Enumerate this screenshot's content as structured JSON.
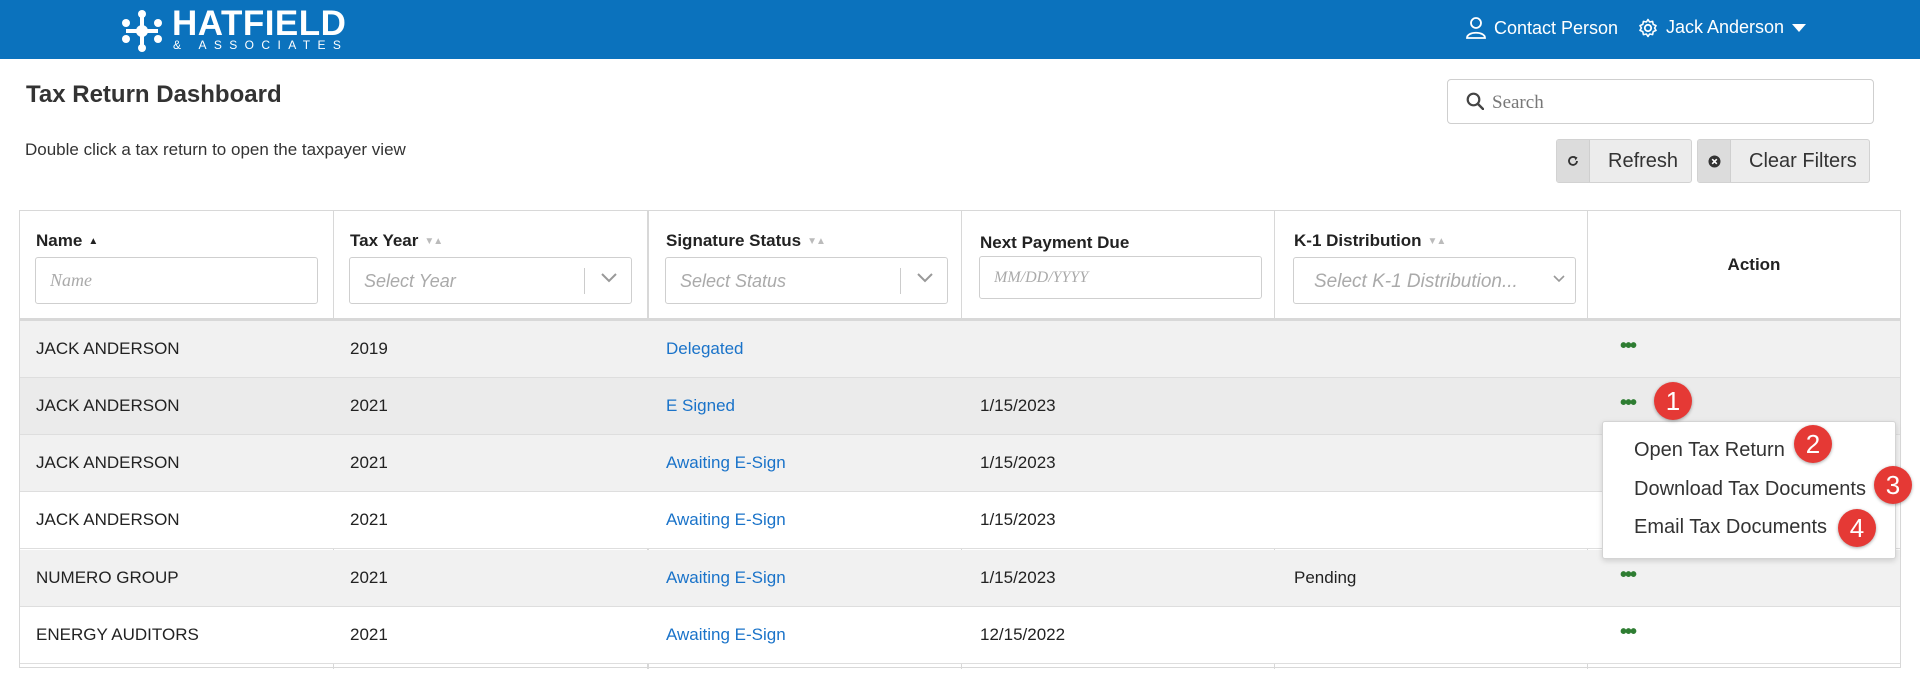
{
  "brand": {
    "name": "HATFIELD",
    "sub": "& ASSOCIATES"
  },
  "topnav": {
    "contact": "Contact Person",
    "user": "Jack Anderson"
  },
  "page": {
    "title": "Tax Return Dashboard",
    "hint": "Double click a tax return to open the taxpayer view"
  },
  "search": {
    "placeholder": "Search"
  },
  "buttons": {
    "refresh": "Refresh",
    "clear": "Clear Filters"
  },
  "columns": {
    "name": {
      "label": "Name",
      "placeholder": "Name"
    },
    "year": {
      "label": "Tax Year",
      "placeholder": "Select Year"
    },
    "status": {
      "label": "Signature Status",
      "placeholder": "Select Status"
    },
    "payment": {
      "label": "Next Payment Due",
      "placeholder": "MM/DD/YYYY"
    },
    "k1": {
      "label": "K-1 Distribution",
      "placeholder": "Select K-1 Distribution..."
    },
    "action": {
      "label": "Action"
    }
  },
  "rows": [
    {
      "name": "JACK ANDERSON",
      "year": "2019",
      "status": "Delegated",
      "payment": "",
      "k1": "",
      "action": "•••"
    },
    {
      "name": "JACK ANDERSON",
      "year": "2021",
      "status": "E Signed",
      "payment": "1/15/2023",
      "k1": "",
      "action": "•••"
    },
    {
      "name": "JACK ANDERSON",
      "year": "2021",
      "status": "Awaiting E-Sign",
      "payment": "1/15/2023",
      "k1": "",
      "action": "•••"
    },
    {
      "name": "JACK ANDERSON",
      "year": "2021",
      "status": "Awaiting E-Sign",
      "payment": "1/15/2023",
      "k1": "",
      "action": "•••"
    },
    {
      "name": "NUMERO GROUP",
      "year": "2021",
      "status": "Awaiting E-Sign",
      "payment": "1/15/2023",
      "k1": "Pending",
      "action": "•••"
    },
    {
      "name": "ENERGY AUDITORS",
      "year": "2021",
      "status": "Awaiting E-Sign",
      "payment": "12/15/2022",
      "k1": "",
      "action": "•••"
    }
  ],
  "menu": {
    "items": [
      "Open Tax Return",
      "Download Tax Documents",
      "Email Tax Documents"
    ]
  },
  "badges": [
    "1",
    "2",
    "3",
    "4"
  ],
  "colors": {
    "brand": "#0b72bd",
    "link": "#1a73c9",
    "action_dots": "#2e7d32",
    "badge": "#e53935"
  }
}
